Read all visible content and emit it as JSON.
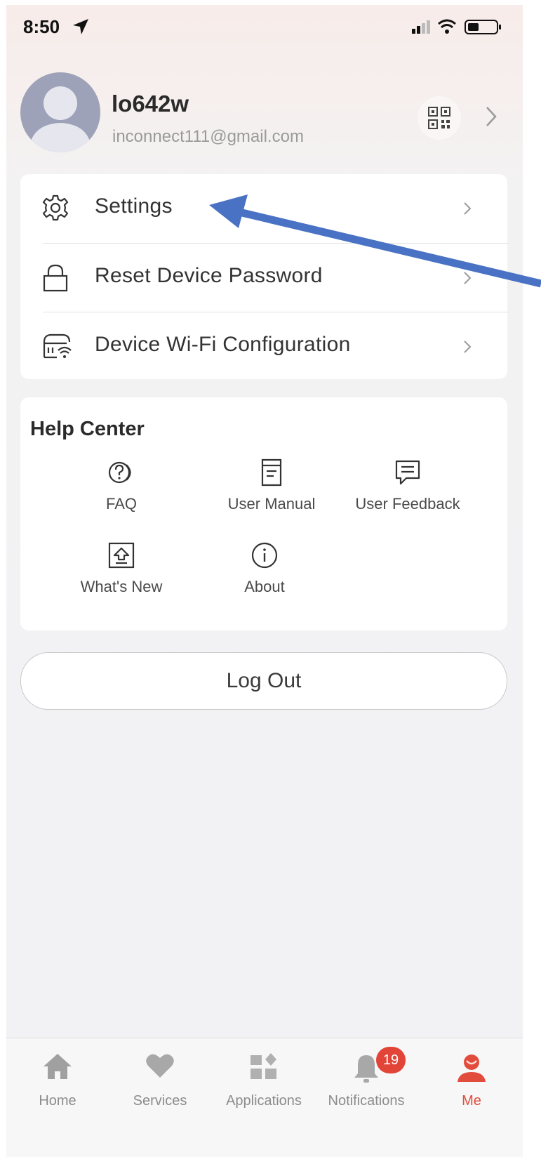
{
  "status_bar": {
    "time": "8:50"
  },
  "profile": {
    "username": "lo642w",
    "email": "inconnect111@gmail.com"
  },
  "menu": {
    "items": [
      {
        "label": "Settings",
        "icon": "gear-icon"
      },
      {
        "label": "Reset Device Password",
        "icon": "lock-icon"
      },
      {
        "label": "Device Wi-Fi Configuration",
        "icon": "router-wifi-icon"
      }
    ]
  },
  "help_center": {
    "title": "Help Center",
    "items": [
      {
        "label": "FAQ",
        "icon": "faq-icon"
      },
      {
        "label": "User Manual",
        "icon": "document-icon"
      },
      {
        "label": "User Feedback",
        "icon": "chat-icon"
      },
      {
        "label": "What's New",
        "icon": "upload-icon"
      },
      {
        "label": "About",
        "icon": "info-icon"
      }
    ]
  },
  "logout": {
    "label": "Log Out"
  },
  "tabbar": {
    "tabs": [
      {
        "label": "Home",
        "icon": "home-icon"
      },
      {
        "label": "Services",
        "icon": "heart-icon"
      },
      {
        "label": "Applications",
        "icon": "apps-icon"
      },
      {
        "label": "Notifications",
        "icon": "bell-icon",
        "badge": "19"
      },
      {
        "label": "Me",
        "icon": "person-icon",
        "active": true
      }
    ]
  },
  "colors": {
    "accent": "#e24c3d",
    "badge": "#e24438",
    "annotation_arrow": "#4a72c4"
  }
}
